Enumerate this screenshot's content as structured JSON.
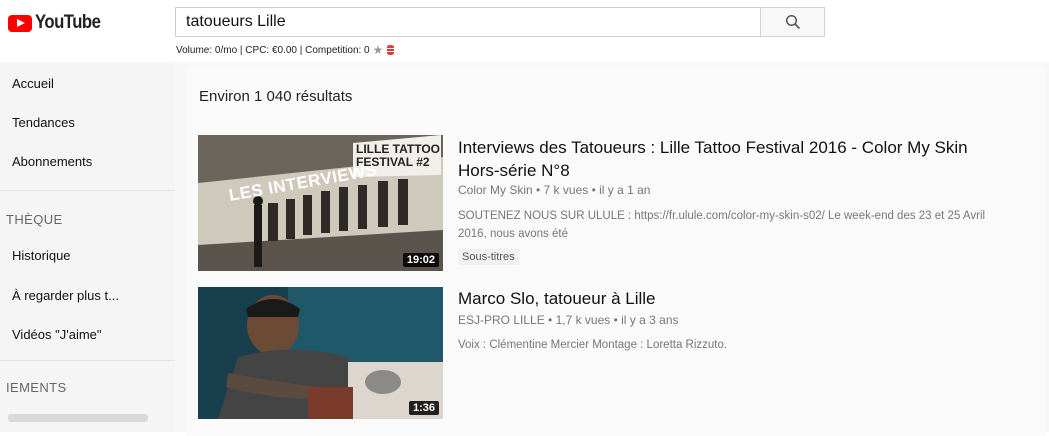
{
  "header": {
    "logo_text": "YouTube",
    "search_value": "tatoueurs Lille",
    "keyword_info": "Volume: 0/mo | CPC: €0.00 | Competition: 0"
  },
  "sidebar": {
    "items_top": [
      "Accueil",
      "Tendances",
      "Abonnements"
    ],
    "library_heading": "THÈQUE",
    "library_items": [
      "Historique",
      "À regarder plus t...",
      "Vidéos \"J'aime\""
    ],
    "subscriptions_heading": "IEMENTS"
  },
  "main": {
    "results_count": "Environ 1 040 résultats",
    "videos": [
      {
        "title_line1": "Interviews des Tatoueurs : Lille Tattoo Festival 2016 - Color My Skin",
        "title_line2": "Hors-série N°8",
        "channel_meta": "Color My Skin • 7 k vues • il y a 1 an",
        "desc_line1": "SOUTENEZ NOUS SUR ULULE : https://fr.ulule.com/color-my-skin-s02/ Le week-end des 23 et 25 Avril",
        "desc_line2": "2016, nous avons été",
        "badge": "Sous-titres",
        "duration": "19:02",
        "thumb_text_1": "LES INTERVIEWS",
        "thumb_text_2": "LILLE TATTOO",
        "thumb_text_3": "FESTIVAL #2"
      },
      {
        "title": "Marco Slo, tatoueur à Lille",
        "channel_meta": "ESJ-PRO LILLE • 1,7 k vues • il y a 3 ans",
        "desc": "Voix : Clémentine Mercier Montage : Loretta Rizzuto.",
        "duration": "1:36"
      }
    ]
  },
  "colors": {
    "brand_red": "#ff0000",
    "sidebar_bg": "#f5f5f5",
    "meta_gray": "#777777"
  },
  "icons": [
    "youtube-logo-icon",
    "search-icon",
    "star-icon",
    "database-icon"
  ]
}
